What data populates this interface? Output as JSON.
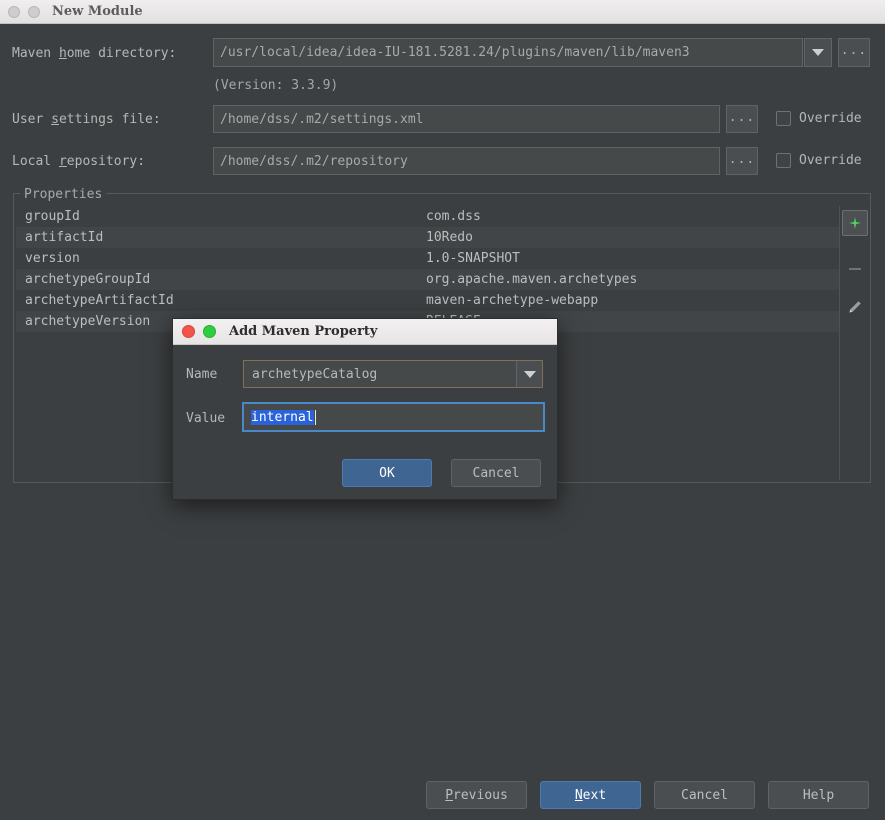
{
  "window": {
    "title": "New Module",
    "traffic_lights": [
      "close-inactive",
      "minimize-inactive"
    ]
  },
  "form": {
    "maven_home": {
      "label_prefix": "Maven ",
      "label_mnemonic": "h",
      "label_suffix": "ome directory:",
      "value": "/usr/local/idea/idea-IU-181.5281.24/plugins/maven/lib/maven3",
      "dropdown_icon": "chevron-down-icon",
      "browse_label": "..."
    },
    "version_note": "(Version: 3.3.9)",
    "user_settings": {
      "label_prefix": "User ",
      "label_mnemonic": "s",
      "label_suffix": "ettings file:",
      "value": "/home/dss/.m2/settings.xml",
      "browse_label": "...",
      "override_label": "Override",
      "override_checked": false
    },
    "local_repository": {
      "label_prefix": "Local ",
      "label_mnemonic": "r",
      "label_suffix": "epository:",
      "value": "/home/dss/.m2/repository",
      "browse_label": "...",
      "override_label": "Override",
      "override_checked": false
    }
  },
  "properties_panel": {
    "title": "Properties",
    "rows": [
      {
        "key": "groupId",
        "value": "com.dss"
      },
      {
        "key": "artifactId",
        "value": "10Redo"
      },
      {
        "key": "version",
        "value": "1.0-SNAPSHOT"
      },
      {
        "key": "archetypeGroupId",
        "value": "org.apache.maven.archetypes"
      },
      {
        "key": "archetypeArtifactId",
        "value": "maven-archetype-webapp"
      },
      {
        "key": "archetypeVersion",
        "value": "RELEASE"
      }
    ],
    "toolbar": {
      "add_icon": "plus-icon",
      "add_color": "#4fd664",
      "remove_icon": "minus-icon",
      "edit_icon": "pencil-icon"
    }
  },
  "dialog": {
    "title": "Add Maven Property",
    "traffic_lights": [
      "close-red",
      "zoom-green"
    ],
    "name_label": "Name",
    "name_value": "archetypeCatalog",
    "name_dropdown_icon": "chevron-down-icon",
    "value_label": "Value",
    "value_text": "internal",
    "value_selected": true,
    "ok_label": "OK",
    "cancel_label": "Cancel"
  },
  "wizard_buttons": {
    "previous": {
      "prefix": "",
      "mnemonic": "P",
      "suffix": "revious"
    },
    "next": {
      "prefix": "",
      "mnemonic": "N",
      "suffix": "ext"
    },
    "cancel": {
      "label": "Cancel"
    },
    "help": {
      "label": "Help"
    }
  },
  "colors": {
    "background": "#3c3f41",
    "field_background": "#45494a",
    "accent_blue": "#3f6593",
    "selection_blue": "#2962d9",
    "focus_border": "#4a88c7",
    "add_green": "#4fd664",
    "titlebar": "#eceaea"
  }
}
